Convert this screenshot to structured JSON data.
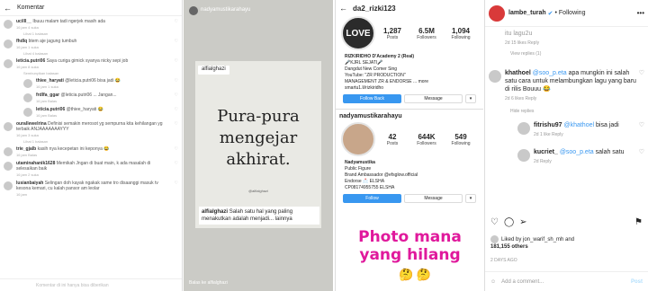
{
  "p1": {
    "title": "Komentar",
    "comments": [
      {
        "user": "ucilll__",
        "text": "Ibuuu malam tadi ngerjek masih ada",
        "meta": "16 jam   4 suka"
      },
      {
        "more": "Lihat 1 balasan"
      },
      {
        "user": "fhdlq",
        "text": "btem aje jagung tumbuh",
        "meta": "16 jam   1 suka"
      },
      {
        "more": "Lihat 4 balasan"
      },
      {
        "user": "leticia.putri06",
        "text": "Saya curiga gimick syanya nicky sepi job",
        "meta": "16 jam   8 suka"
      },
      {
        "more": "Sembunyikan balasan"
      },
      {
        "user": "thiee_haryati",
        "text": "@leticia.putri06 bisa jadi 😂",
        "meta": "16 jam   1 suka",
        "reply": true
      },
      {
        "user": "frdlfa_ggar",
        "text": "@leticia.putri06 ... Jangan...",
        "meta": "16 jam   Balas",
        "reply": true
      },
      {
        "user": "leticia.putri06",
        "text": "@thiee_haryati 😂",
        "meta": "16 jam   Balas",
        "reply": true
      },
      {
        "user": "ourallewelrina",
        "text": "Definisi semakin merosot yg sempurna kita kehilangan yg terbaik ANJAAAAAAAYYY",
        "meta": "16 jam   3 suka"
      },
      {
        "more": "Lihat 1 balasan"
      },
      {
        "user": "trie_gjalb",
        "text": "kasih nya kecepetan ini keponya 😂",
        "meta": "16 jam   Balas"
      },
      {
        "user": "utaminahanik1628",
        "text": "Memikah Jngan di buat main, k ada masalah di selesaikan baik",
        "meta": "16 jam   2 suka"
      },
      {
        "user": "lusianbaiyah",
        "text": "Selingan doh kayak ngakak same tro disaanggi masuk tv kesona kemari, cu kalah pansor am leolar",
        "meta": "16 jam"
      }
    ],
    "footer": "Komentar di ini hanya bisa diberikan"
  },
  "p2": {
    "account": "nadyamustikarahayu",
    "tag": "alfialghazi",
    "quote_lines": [
      "Pura-pura",
      "mengejar",
      "akhirat."
    ],
    "handle": "@alfialghazi",
    "caption_user": "alfialghazi",
    "caption": "Salah satu hal yang paling menakutkan adalah menjadi... lainnya",
    "footer": "Balas ke alfialghazi"
  },
  "p3": {
    "username": "da2_rizki123",
    "avatar_text": "LOVE",
    "stats": [
      {
        "n": "1,287",
        "l": "Posts"
      },
      {
        "n": "6.5M",
        "l": "Followers"
      },
      {
        "n": "1,094",
        "l": "Following"
      }
    ],
    "bio": [
      "RIZKIRIDHO D'Academy 2 (Real)",
      "🎤KJRL SEJATI🎤",
      "Dangdut New Comer Sing",
      "YouTube: \"ZR PRODUCTION\"",
      "MANAGEMENT ZR & ENDORSE ... more",
      "smartu1.li/rizkiridho"
    ],
    "follow_back": "Follow Back",
    "message": "Message",
    "username2": "nadyamustikarahayu",
    "stats2": [
      {
        "n": "42",
        "l": "Posts"
      },
      {
        "n": "644K",
        "l": "Followers"
      },
      {
        "n": "549",
        "l": "Following"
      }
    ],
    "bio2": [
      "Nadyamustika",
      "Public Figure",
      "Brand Ambassador @efsglow.official",
      "Endorse 📩 ELSHA",
      "CP08174955755 ELSHA"
    ],
    "follow": "Follow",
    "message2": "Message",
    "meme_lines": [
      "Photo mana",
      "yang hilang"
    ],
    "emojis": "🤔 🤔"
  },
  "p4": {
    "user": "lambe_turah",
    "following": "• Following",
    "top_text": "itu lagu2u",
    "top_meta": "2d   15 likes   Reply",
    "vr1": "View replies (1)",
    "c1_user": "khathoel",
    "c1_mention": "@soo_p.eta",
    "c1_text": "apa mungkin ini salah satu cara untuk melambungkan lagu yang baru di rilis Bouuu 😂",
    "c1_meta": "2d   6 likes   Reply",
    "vr2": "Hide replies",
    "r1_user": "fitrishu97",
    "r1_mention": "@khathoel",
    "r1_text": "bisa jadi",
    "r1_meta": "2d   1 like   Reply",
    "r2_user": "kucriet_",
    "r2_mention": "@soo_p.eta",
    "r2_text": "salah satu",
    "r2_meta": "2d   Reply",
    "liked_by": "Liked by jon_warif_sh_mh and",
    "likes": "181,155 others",
    "ago": "2 DAYS AGO",
    "add": "Add a comment...",
    "post": "Post"
  }
}
